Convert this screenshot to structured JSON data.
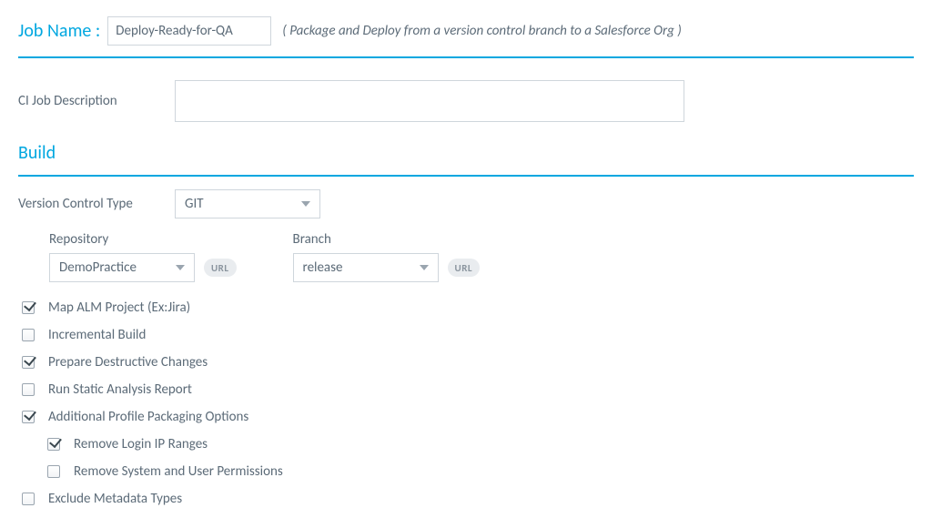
{
  "job": {
    "name_label": "Job Name :",
    "name_value": "Deploy-Ready-for-QA",
    "desc": "Package and Deploy from a version control branch to a Salesforce Org"
  },
  "ci_desc": {
    "label": "CI Job Description",
    "value": ""
  },
  "build": {
    "heading": "Build",
    "vctype_label": "Version Control Type",
    "vctype_value": "GIT",
    "repo_label": "Repository",
    "repo_value": "DemoPractice",
    "branch_label": "Branch",
    "branch_value": "release",
    "url_chip": "URL"
  },
  "checks": {
    "map_alm": {
      "label": "Map ALM Project (Ex:Jira)",
      "checked": true
    },
    "inc_build": {
      "label": "Incremental Build",
      "checked": false
    },
    "prep_dest": {
      "label": "Prepare Destructive Changes",
      "checked": true
    },
    "static": {
      "label": "Run Static Analysis Report",
      "checked": false
    },
    "addl_prof": {
      "label": "Additional Profile Packaging Options",
      "checked": true
    },
    "remove_ip": {
      "label": "Remove Login IP Ranges",
      "checked": true
    },
    "remove_perm": {
      "label": "Remove System and User Permissions",
      "checked": false
    },
    "excl_meta": {
      "label": "Exclude Metadata Types",
      "checked": false
    }
  }
}
